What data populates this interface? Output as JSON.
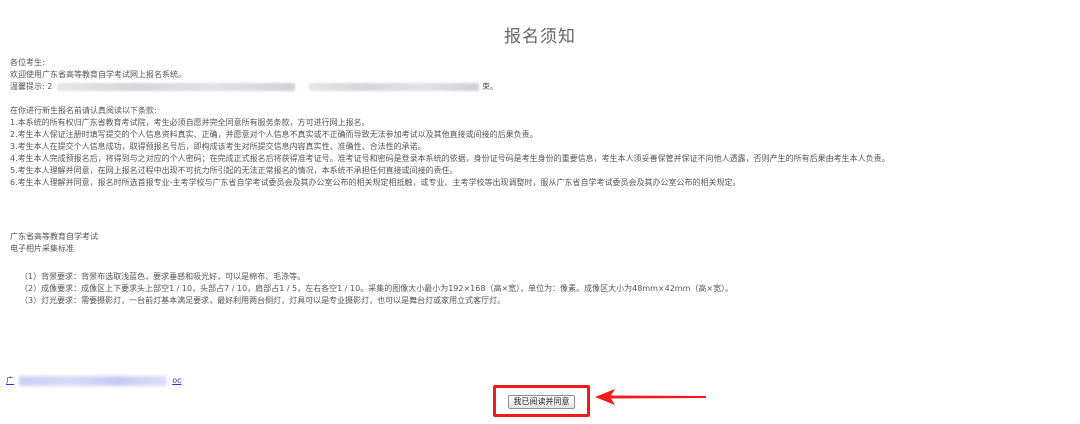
{
  "page": {
    "title": "报名须知"
  },
  "greeting": {
    "salutation": "各位考生:",
    "welcome": "欢迎使用广东省高等教育自学考试网上报名系统。",
    "tip_prefix": "温馨提示: 2",
    "tip_suffix": "束。"
  },
  "terms": {
    "intro": "在你进行新生报名前请认真阅读以下条款:",
    "items": [
      "1.本系统的所有权归广东省教育考试院，考生必须自愿并完全同意所有服务条款，方可进行网上报名。",
      "2.考生本人保证注册时填写提交的个人信息资料真实、正确，并愿意对个人信息不真实或不正确而导致无法参加考试以及其他直接或间接的后果负责。",
      "3.考生本人在提交个人信息成功，取得预报名号后，即构成该考生对所提交信息内容真实性、准确性、合法性的承诺。",
      "4.考生本人完成预报名后，将得到与之对应的个人密码；在完成正式报名后将获得准考证号。准考证号和密码是登录本系统的依据，身份证号码是考生身份的重要信息，考生本人须妥善保管并保证不向他人透露，否则产生的所有后果由考生本人负责。",
      "5.考生本人理解并同意，在网上报名过程中出现不可抗力所引起的无法正常报名的情况，本系统不承担任何直接或间接的责任。",
      "6.考生本人理解并同意，报名时所选首报专业-主考学校与广东省自学考试委员会及其办公室公布的相关规定相抵触，或专业、主考学校等出现调整时，服从广东省自学考试委员会及其办公室公布的相关规定。"
    ]
  },
  "photo_standard": {
    "org": "广东省高等教育自学考试",
    "title": "电子相片采集标准",
    "items": [
      "（1）背景要求：背景布选取浅蓝色，要求垂感和吸光好，可以是棉布、毛涤等。",
      "（2）成像要求：成像区上下要求头上部空1 / 10，头部占7 / 10，肩部占1 / 5，左右各空1 / 10。采集的图像大小最小为192×168（高×宽），单位为：像素。成像区大小为48mm×42mm（高×宽）。",
      "（3）灯光要求：需要摄影灯，一台前灯基本满足要求，最好利用两台侧灯，灯具可以是专业摄影灯，也可以是舞台灯或家用立式客厅灯。"
    ]
  },
  "download_link": {
    "start": "广",
    "end": "oc"
  },
  "agree": {
    "label": "我已阅读并同意"
  },
  "colors": {
    "highlight": "#ee1c1c",
    "link": "#1a3ccf",
    "title": "#666666",
    "text": "#555555"
  }
}
